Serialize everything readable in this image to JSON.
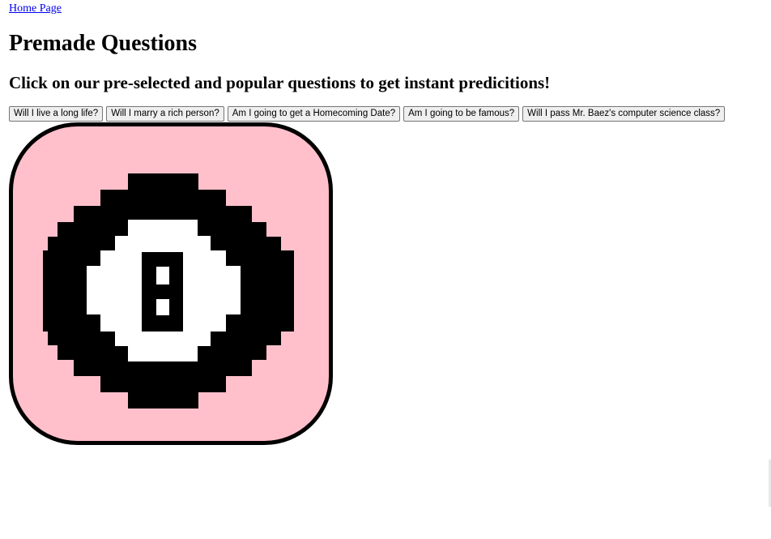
{
  "nav": {
    "home_link": "Home Page"
  },
  "header": {
    "title": "Premade Questions",
    "subtitle": "Click on our pre-selected and popular questions to get instant predicitions!"
  },
  "questions": [
    {
      "label": "Will I live a long life?"
    },
    {
      "label": "Will I marry a rich person?"
    },
    {
      "label": "Am I going to get a Homecoming Date?"
    },
    {
      "label": "Am I going to be famous?"
    },
    {
      "label": "Will I pass Mr. Baez's computer science class?"
    }
  ],
  "image": {
    "icon": "magic-8-ball-icon",
    "colors": {
      "background": "#ffc0cb",
      "outline": "#000000",
      "ball_face": "#ffffff"
    }
  },
  "colors": {
    "link": "#0000ee",
    "page_background": "#ffffff"
  }
}
